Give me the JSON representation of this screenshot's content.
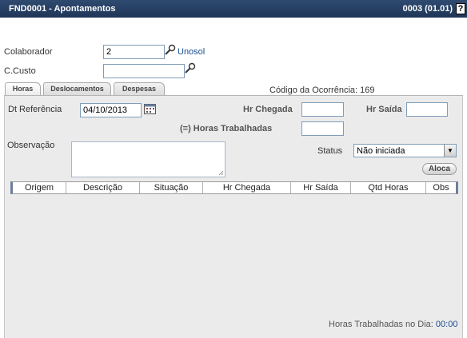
{
  "titlebar": {
    "title": "FND0001 - Apontamentos",
    "version": "0003 (01.01)",
    "help_label": "?"
  },
  "form": {
    "colaborador_label": "Colaborador",
    "colaborador_value": "2",
    "colaborador_link": "Unosol",
    "ccusto_label": "C.Custo",
    "ccusto_value": ""
  },
  "tabs": [
    {
      "label": "Horas",
      "active": true
    },
    {
      "label": "Deslocamentos",
      "active": false
    },
    {
      "label": "Despesas",
      "active": false
    }
  ],
  "ocorrencia": "Código da Ocorrência: 169",
  "horas": {
    "dt_ref_label": "Dt Referência",
    "dt_ref_value": "04/10/2013",
    "hr_chegada_label": "Hr Chegada",
    "hr_chegada_value": "",
    "hr_saida_label": "Hr Saída",
    "hr_saida_value": "",
    "horas_trab_label": "(=) Horas Trabalhadas",
    "horas_trab_value": "",
    "observacao_label": "Observação",
    "status_label": "Status",
    "status_value": "Não iniciada",
    "aloca_label": "Aloca"
  },
  "grid": {
    "columns": [
      "Origem",
      "Descrição",
      "Situação",
      "Hr Chegada",
      "Hr Saída",
      "Qtd Horas",
      "Obs"
    ]
  },
  "footer": {
    "label": "Horas Trabalhadas no Dia:",
    "value": "00:00"
  },
  "colors": {
    "titlebar": "#1f3658",
    "panel": "#ebebeb",
    "link": "#1a4d8f"
  }
}
